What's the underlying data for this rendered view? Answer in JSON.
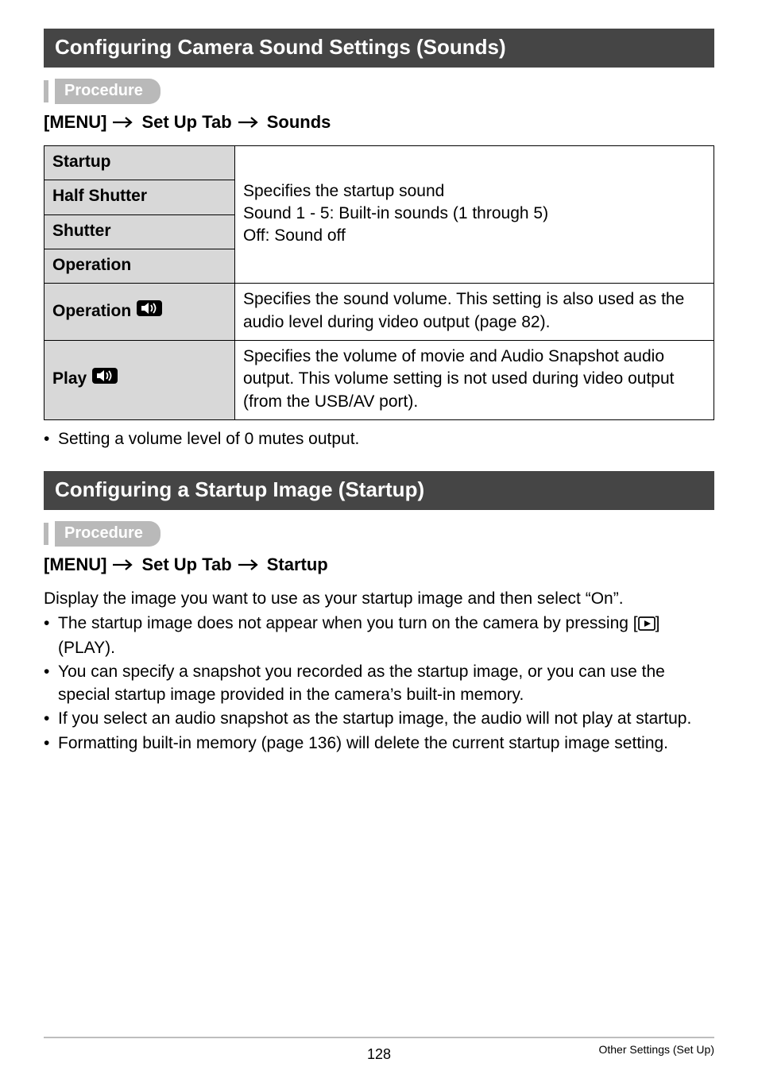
{
  "section1": {
    "title": "Configuring Camera Sound Settings (Sounds)",
    "procedure_label": "Procedure",
    "menu_path": [
      "[MENU]",
      "Set Up Tab",
      "Sounds"
    ],
    "table": {
      "rows_group1": [
        {
          "label": "Startup"
        },
        {
          "label": "Half Shutter"
        },
        {
          "label": "Shutter"
        },
        {
          "label": "Operation"
        }
      ],
      "group1_desc_line1": "Specifies the startup sound",
      "group1_desc_line2": "Sound 1 - 5: Built-in sounds (1 through 5)",
      "group1_desc_line3": "Off: Sound off",
      "row_operation_vol": {
        "label": "Operation",
        "desc": "Specifies the sound volume. This setting is also used as the audio level during video output (page 82)."
      },
      "row_play_vol": {
        "label": "Play",
        "desc": "Specifies the volume of movie and Audio Snapshot audio output. This volume setting is not used during video output (from the USB/AV port)."
      }
    },
    "note": "Setting a volume level of 0 mutes output."
  },
  "section2": {
    "title": "Configuring a Startup Image (Startup)",
    "procedure_label": "Procedure",
    "menu_path": [
      "[MENU]",
      "Set Up Tab",
      "Startup"
    ],
    "intro": "Display the image you want to use as your startup image and then select “On”.",
    "bullets": [
      {
        "pre": "The startup image does not appear when you turn on the camera by pressing [",
        "post": "] (PLAY)."
      },
      {
        "text": "You can specify a snapshot you recorded as the startup image, or you can use the special startup image provided in the camera’s built-in memory."
      },
      {
        "text": "If you select an audio snapshot as the startup image, the audio will not play at startup."
      },
      {
        "text": "Formatting built-in memory (page 136) will delete the current startup image setting."
      }
    ]
  },
  "footer": {
    "page": "128",
    "right": "Other Settings (Set Up)"
  }
}
